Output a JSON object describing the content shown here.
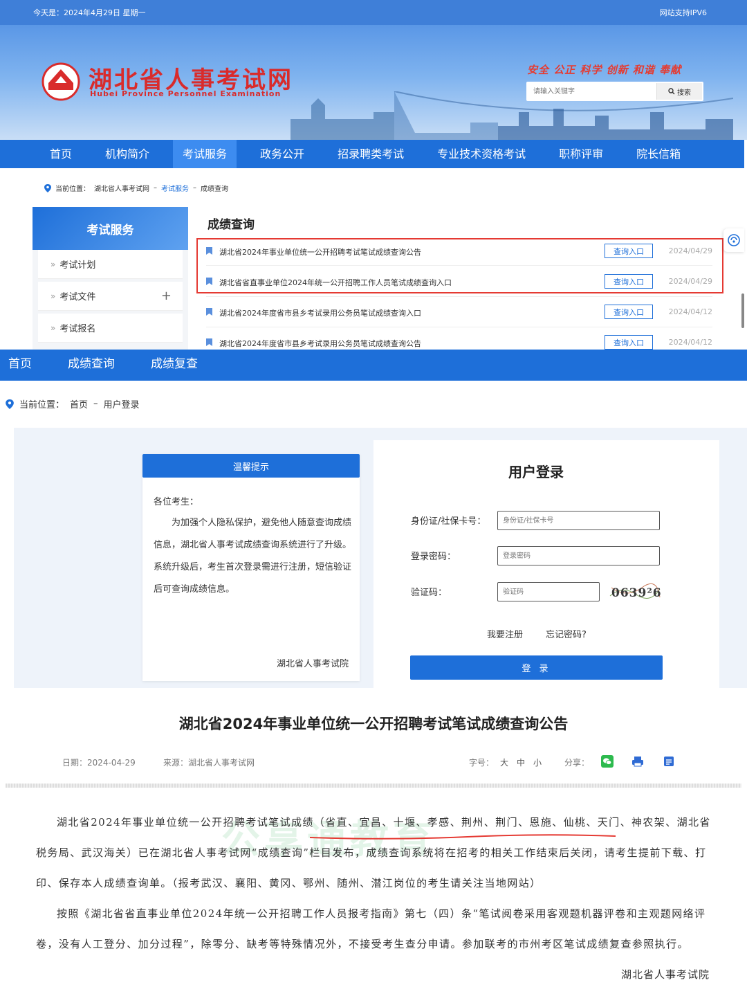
{
  "portal": {
    "top_bar": {
      "date": "今天是：2024年4月29日 星期一",
      "ipv6": "网站支持IPV6"
    },
    "logo": {
      "name_cn": "湖北省人事考试网",
      "name_en": "Hubei  Province  Personnel  Examination",
      "badge": "HBPTA"
    },
    "slogan": "安全  公正  科学  创新  和谐  奉献",
    "search": {
      "placeholder": "请输入关键字",
      "button": "搜索"
    },
    "nav": [
      "首页",
      "机构简介",
      "考试服务",
      "政务公开",
      "招录聘类考试",
      "专业技术资格考试",
      "职称评审",
      "院长信箱"
    ],
    "nav_active": "考试服务",
    "breadcrumb": {
      "label": "当前位置：",
      "items": [
        "湖北省人事考试网",
        "考试服务",
        "成绩查询"
      ],
      "sep": "–"
    },
    "sidebar": {
      "title": "考试服务",
      "items": [
        "考试计划",
        "考试文件",
        "考试报名"
      ],
      "expand_symbol": "+"
    },
    "content_title": "成绩查询",
    "notices": [
      {
        "title": "湖北省2024年事业单位统一公开招聘考试笔试成绩查询公告",
        "button": "查询入口",
        "date": "2024/04/29"
      },
      {
        "title": "湖北省省直事业单位2024年统一公开招聘工作人员笔试成绩查询入口",
        "button": "查询入口",
        "date": "2024/04/29"
      },
      {
        "title": "湖北省2024年度省市县乡考试录用公务员笔试成绩查询入口",
        "button": "查询入口",
        "date": "2024/04/12"
      },
      {
        "title": "湖北省2024年度省市县乡考试录用公务员笔试成绩查询公告",
        "button": "查询入口",
        "date": "2024/04/12"
      }
    ]
  },
  "login_page": {
    "nav": [
      "首页",
      "成绩查询",
      "成绩复查"
    ],
    "breadcrumb": {
      "label": "当前位置：",
      "items": [
        "首页",
        "用户登录"
      ],
      "sep": "–"
    },
    "tip": {
      "header": "温馨提示",
      "greeting": "各位考生：",
      "body": "为加强个人隐私保护，避免他人随意查询成绩信息，湖北省人事考试成绩查询系统进行了升级。系统升级后，考生首次登录需进行注册，短信验证后可查询成绩信息。",
      "signature": "湖北省人事考试院"
    },
    "form": {
      "title": "用户登录",
      "id_label": "身份证/社保卡号：",
      "id_placeholder": "身份证/社保卡号",
      "password_label": "登录密码：",
      "password_placeholder": "登录密码",
      "captcha_label": "验证码：",
      "captcha_placeholder": "验证码",
      "captcha_text": "0639²6",
      "register": "我要注册",
      "forgot": "忘记密码?",
      "submit": "登 录"
    }
  },
  "article": {
    "title": "湖北省2024年事业单位统一公开招聘考试笔试成绩查询公告",
    "date": "日期：2024-04-29",
    "source": "来源：湖北省人事考试网",
    "font_size": {
      "label": "字号：",
      "options": [
        "大",
        "中",
        "小"
      ]
    },
    "share_label": "分享：",
    "share_icons": [
      "wechat-icon",
      "print-icon",
      "bookmark-icon"
    ],
    "paragraphs": [
      "湖北省2024年事业单位统一公开招聘考试笔试成绩（省直、宜昌、十堰、孝感、荆州、荆门、恩施、仙桃、天门、神农架、湖北省税务局、武汉海关）已在湖北省人事考试网“成绩查询”栏目发布，成绩查询系统将在招考的相关工作结束后关闭，请考生提前下载、打印、保存本人成绩查询单。（报考武汉、襄阳、黄冈、鄂州、随州、潜江岗位的考生请关注当地网站）",
      "按照《湖北省省直事业单位2024年统一公开招聘工作人员报考指南》第七（四）条“笔试阅卷采用客观题机器评卷和主观题网络评卷，没有人工登分、加分过程”，除零分、缺考等特殊情况外，不接受考生查分申请。参加联考的市州考区笔试成绩复查参照执行。"
    ],
    "signature": "湖北省人事考试院",
    "watermark": "公享通教育"
  },
  "colors": {
    "primary": "#1e6fd9",
    "highlight_red": "#e53a33",
    "logo_red": "#d92b2b"
  }
}
